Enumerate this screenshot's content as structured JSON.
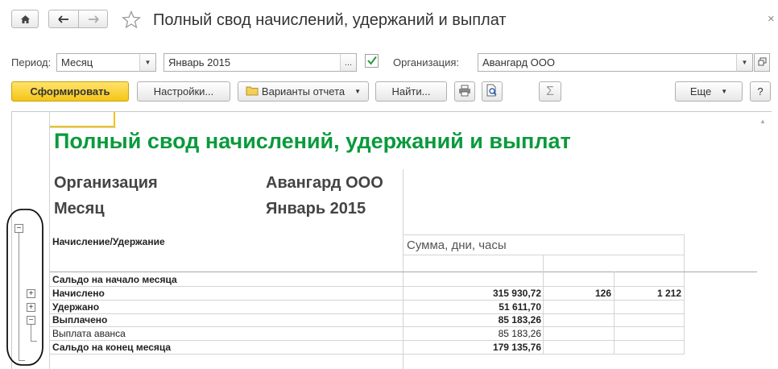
{
  "window": {
    "title": "Полный свод начислений, удержаний и выплат",
    "close_glyph": "×",
    "icons": {
      "home": "home-icon",
      "back": "arrow-left-icon",
      "forward": "arrow-right-icon",
      "favorite": "star-icon"
    }
  },
  "filters": {
    "period_label": "Период:",
    "period_value": "Месяц",
    "month_value": "Январь 2015",
    "month_select_glyph": "...",
    "org_label": "Организация:",
    "org_value": "Авангард ООО",
    "checkbox_checked": true
  },
  "toolbar": {
    "generate": "Сформировать",
    "settings": "Настройки...",
    "variants": "Варианты отчета",
    "find": "Найти...",
    "sum_glyph": "Σ",
    "more": "Еще",
    "help": "?"
  },
  "report": {
    "title": "Полный свод начислений, удержаний и выплат",
    "title_color": "#0a9a3c",
    "params": [
      {
        "label": "Организация",
        "value": "Авангард ООО"
      },
      {
        "label": "Месяц",
        "value": "Январь 2015"
      }
    ],
    "header_left": "Начисление/Удержание",
    "header_right": "Сумма, дни, часы",
    "rows": [
      {
        "label": "Сальдо на начало месяца",
        "bold": true,
        "sum": "",
        "days": "",
        "hours": ""
      },
      {
        "label": "Начислено",
        "bold": true,
        "sum": "315 930,72",
        "days": "126",
        "hours": "1 212"
      },
      {
        "label": "Удержано",
        "bold": true,
        "sum": "51 611,70",
        "days": "",
        "hours": ""
      },
      {
        "label": "Выплачено",
        "bold": true,
        "sum": "85 183,26",
        "days": "",
        "hours": ""
      },
      {
        "label": "Выплата аванса",
        "bold": false,
        "sum": "85 183,26",
        "days": "",
        "hours": ""
      },
      {
        "label": "Сальдо на конец месяца",
        "bold": true,
        "sum": "179 135,76",
        "days": "",
        "hours": ""
      }
    ],
    "group_toggles": [
      "−",
      "+",
      "+",
      "−"
    ]
  }
}
